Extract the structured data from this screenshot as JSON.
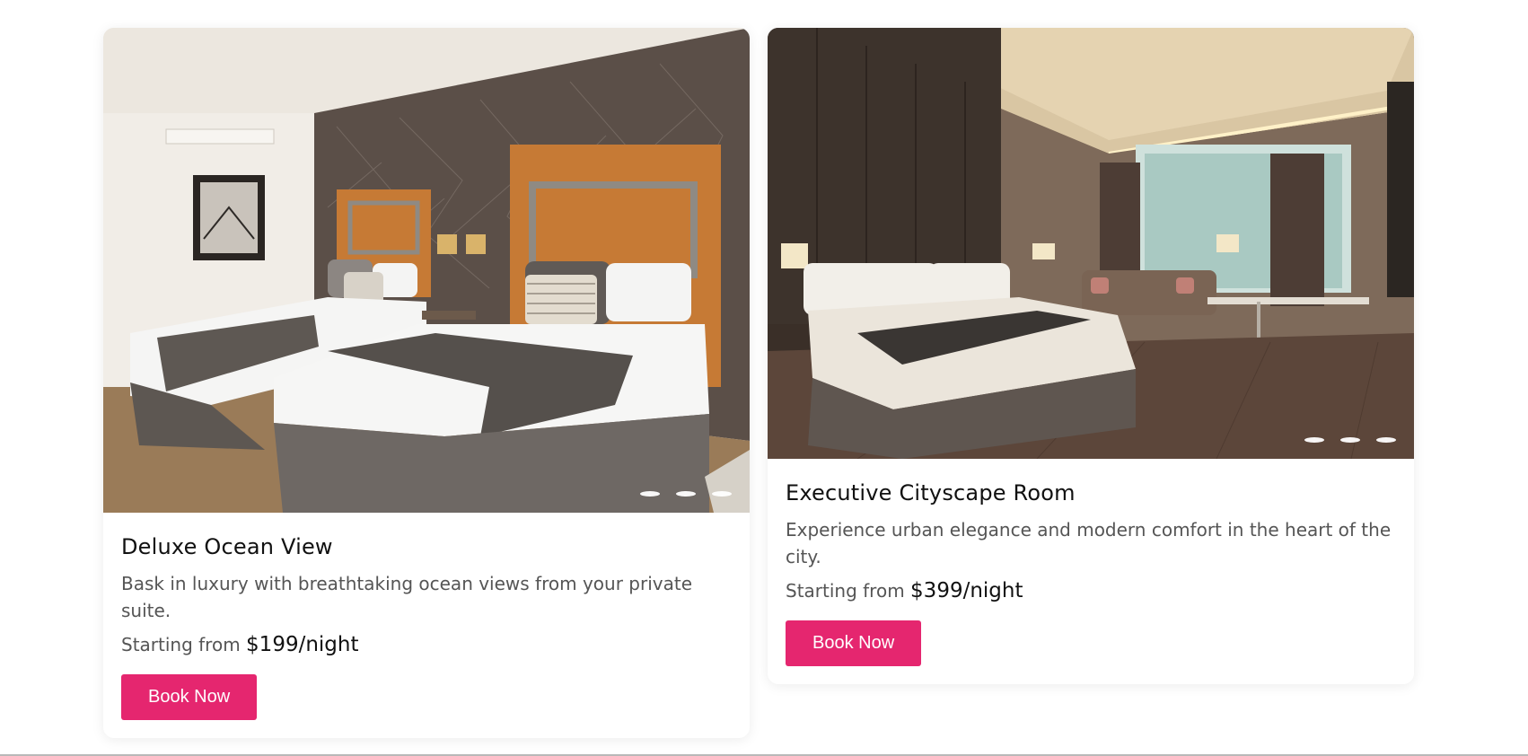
{
  "rooms": [
    {
      "name": "Deluxe Ocean View",
      "description": "Bask in luxury with breathtaking ocean views from your private suite.",
      "price_prefix": "Starting from",
      "price": "$199/night",
      "button_label": "Book Now",
      "image": "twin-bed-hotel-room-photo",
      "slide_count": 3
    },
    {
      "name": "Executive Cityscape Room",
      "description": "Experience urban elegance and modern comfort in the heart of the city.",
      "price_prefix": "Starting from",
      "price": "$399/night",
      "button_label": "Book Now",
      "image": "king-bed-hotel-room-photo",
      "slide_count": 3
    }
  ],
  "colors": {
    "button": "#e5266f",
    "title": "#111111",
    "text": "#555555"
  }
}
